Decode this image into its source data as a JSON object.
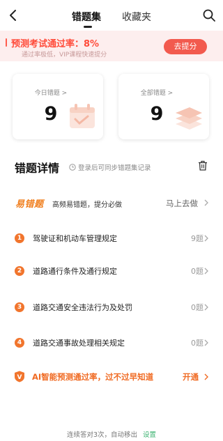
{
  "nav": {
    "tab_wrong": "错题集",
    "tab_favorites": "收藏夹"
  },
  "banner": {
    "title": "预测考试通过率：8%",
    "subtitle": "通过率极低，VIP课程快速提分",
    "button_label": "去提分"
  },
  "cards": {
    "today": {
      "label": "今日错题 >",
      "count": "9"
    },
    "all": {
      "label": "全部错题 >",
      "count": "9"
    }
  },
  "details": {
    "title": "错题详情",
    "note": "登录后可同步错题集记录"
  },
  "easy": {
    "logo": "易错题",
    "desc": "高频易错题，提分必做",
    "action": "马上去做"
  },
  "chapters": [
    {
      "index": "1",
      "label": "驾驶证和机动车管理规定",
      "count": "9题"
    },
    {
      "index": "2",
      "label": "道路通行条件及通行规定",
      "count": "0题"
    },
    {
      "index": "3",
      "label": "道路交通安全违法行为及处罚",
      "count": "0题"
    },
    {
      "index": "4",
      "label": "道路交通事故处理相关规定",
      "count": "0题"
    }
  ],
  "ai": {
    "badge": "V",
    "text": "AI智能预测通过率，过不过早知道",
    "action": "开通"
  },
  "footer": {
    "text": "连续答对3次，自动移出",
    "setting": "设置"
  },
  "colors": {
    "accent": "#f25a4e",
    "orange": "#f1752d",
    "banner_bg": "#fdeeee",
    "green": "#3cb371"
  }
}
